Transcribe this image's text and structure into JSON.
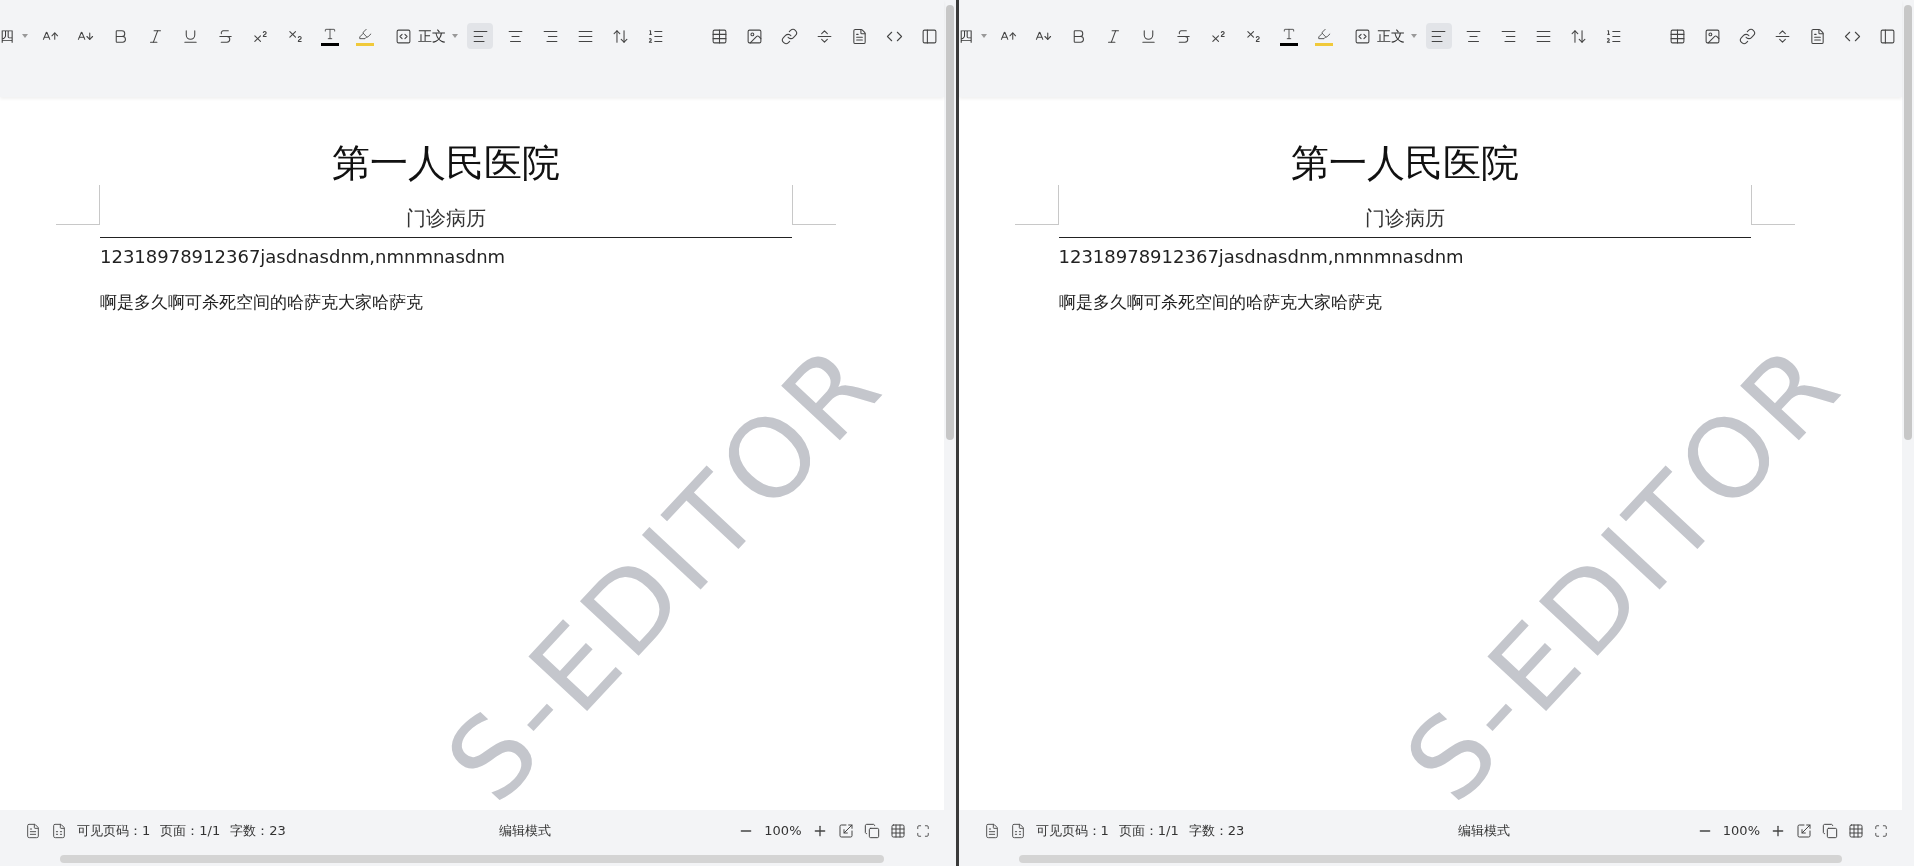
{
  "panes": [
    {
      "toolbar": {
        "font_size": "四",
        "paragraph_style": "正文",
        "font_color": {
          "color": "#000000"
        },
        "highlight": {
          "color": "#f0c93a"
        },
        "align_buttons": [
          {
            "selected": true
          },
          {
            "selected": false
          },
          {
            "selected": false
          },
          {
            "selected": false
          }
        ]
      },
      "document": {
        "title": "第一人民医院",
        "subtitle": "门诊病历",
        "lines": [
          "12318978912367jasdnasdnm,nmnmnasdnm",
          "啊是多久啊可杀死空间的哈萨克大家哈萨克"
        ],
        "watermark": "S-EDITOR"
      },
      "status_bar": {
        "visible_page": "可见页码：1",
        "page": "页面：1/1",
        "word_count": "字数：23",
        "mode": "编辑模式",
        "zoom": "100%"
      }
    },
    {
      "toolbar": {
        "font_size": "四",
        "paragraph_style": "正文",
        "font_color": {
          "color": "#000000"
        },
        "highlight": {
          "color": "#f0c93a"
        },
        "align_buttons": [
          {
            "selected": true
          },
          {
            "selected": false
          },
          {
            "selected": false
          },
          {
            "selected": false
          }
        ]
      },
      "document": {
        "title": "第一人民医院",
        "subtitle": "门诊病历",
        "lines": [
          "12318978912367jasdnasdnm,nmnmnasdnm",
          "啊是多久啊可杀死空间的哈萨克大家哈萨克"
        ],
        "watermark": "S-EDITOR"
      },
      "status_bar": {
        "visible_page": "可见页码：1",
        "page": "页面：1/1",
        "word_count": "字数：23",
        "mode": "编辑模式",
        "zoom": "100%"
      }
    }
  ]
}
